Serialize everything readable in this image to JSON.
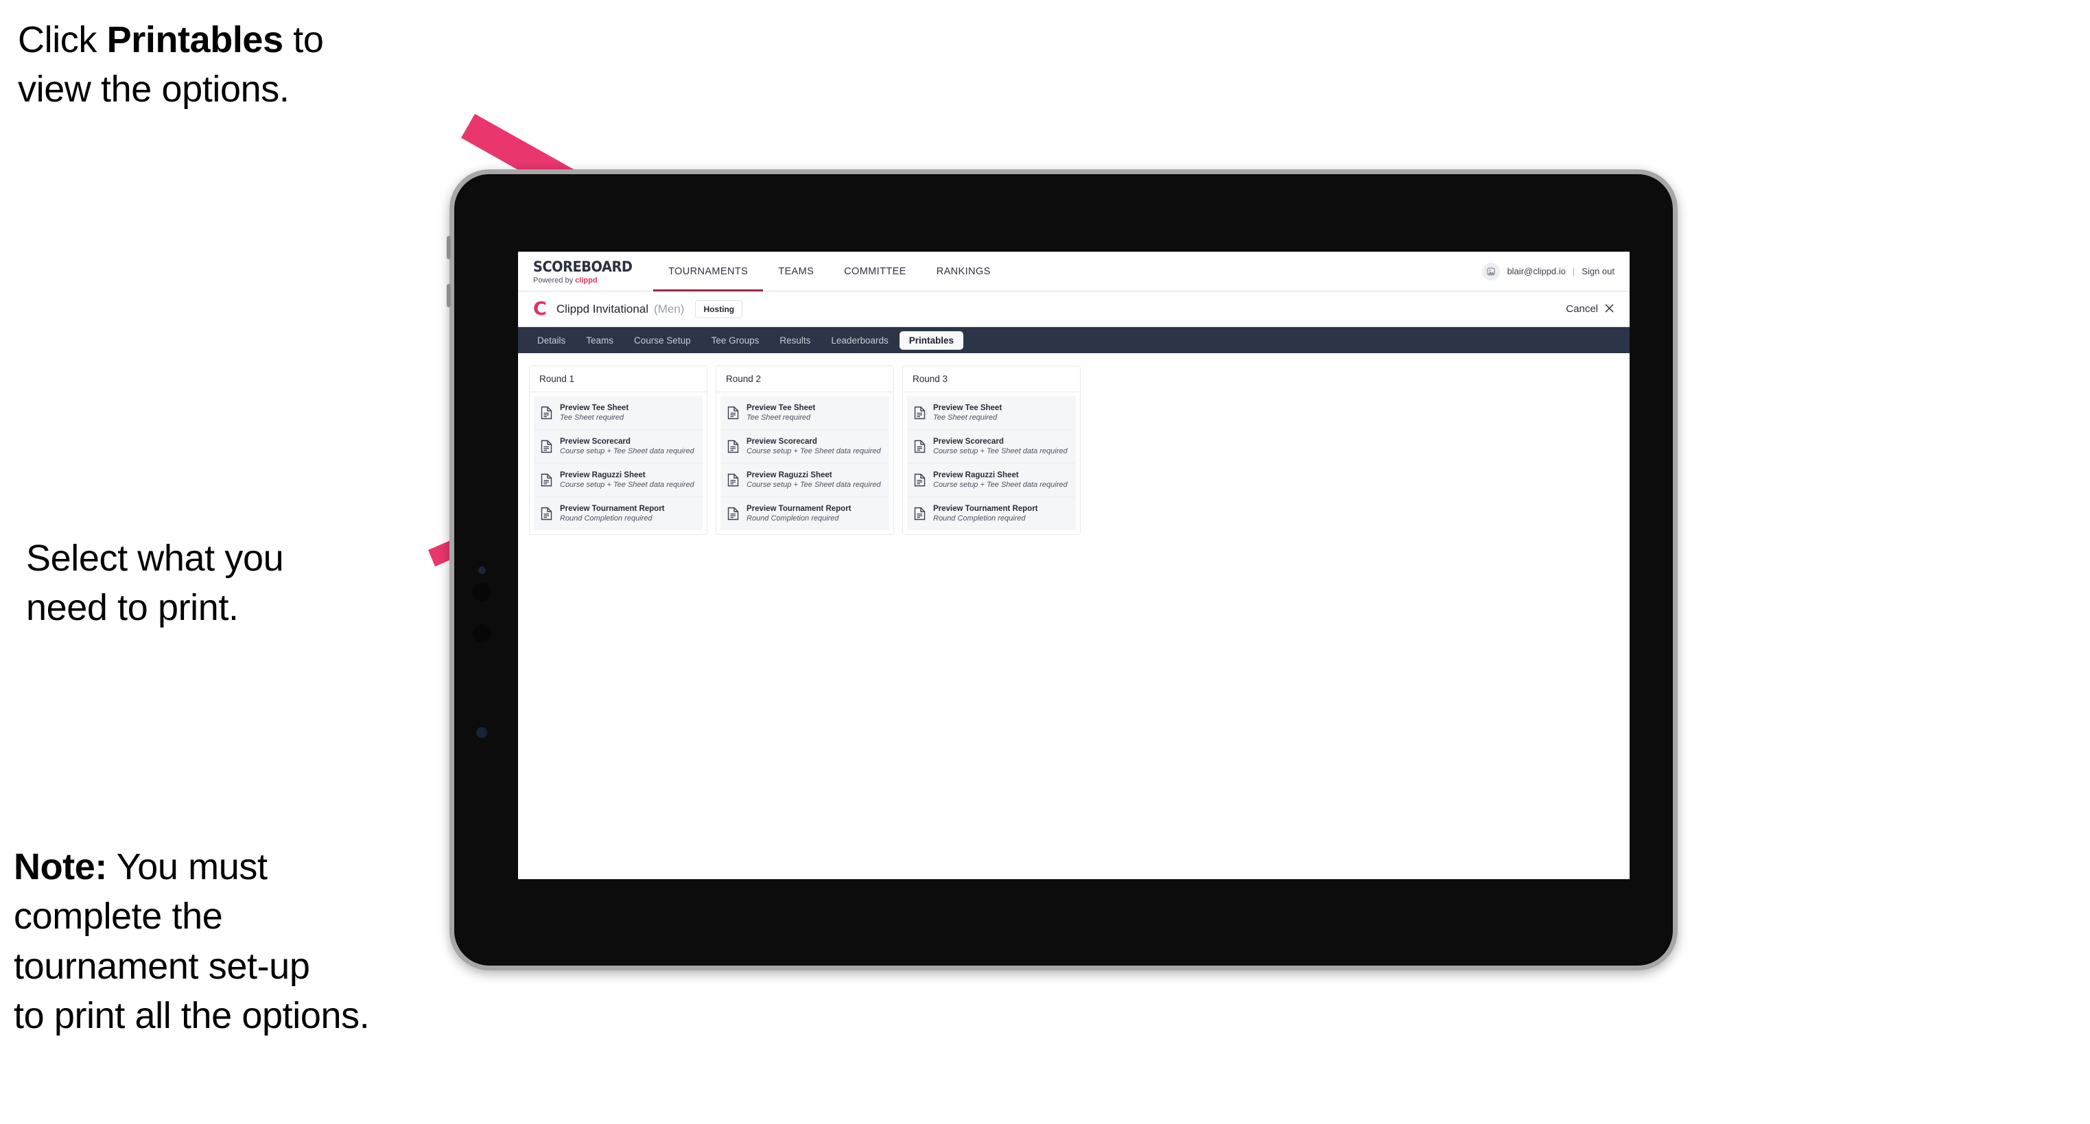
{
  "annotations": {
    "click_printables": "Click Printables to view the options.",
    "click_printables_pre": "Click ",
    "click_printables_bold": "Printables",
    "click_printables_post": " to\nview the options.",
    "select_print": "Select what you\n need to print.",
    "note_bold": "Note:",
    "note_rest": " You must\ncomplete the\ntournament set-up\nto print all the options."
  },
  "colors": {
    "accent_pink": "#e9366d",
    "brand_pink": "#e0335f",
    "tabbar_bg": "#2b3547",
    "active_underline": "#9c2744"
  },
  "app": {
    "brand": {
      "title": "SCOREBOARD",
      "subtitle_pre": "Powered by ",
      "subtitle_brand": "clippd"
    },
    "topnav": {
      "items": [
        {
          "label": "TOURNAMENTS",
          "active": true
        },
        {
          "label": "TEAMS",
          "active": false
        },
        {
          "label": "COMMITTEE",
          "active": false
        },
        {
          "label": "RANKINGS",
          "active": false
        }
      ],
      "user": {
        "avatar_icon": "user-avatar-icon",
        "email": "blair@clippd.io",
        "separator": "|",
        "sign_out": "Sign out"
      }
    },
    "subheader": {
      "logo_letter": "C",
      "tournament_name": "Clippd Invitational",
      "gender": "(Men)",
      "status_badge": "Hosting",
      "cancel_label": "Cancel",
      "cancel_icon": "close-icon"
    },
    "tabs": [
      {
        "label": "Details",
        "active": false
      },
      {
        "label": "Teams",
        "active": false
      },
      {
        "label": "Course Setup",
        "active": false
      },
      {
        "label": "Tee Groups",
        "active": false
      },
      {
        "label": "Results",
        "active": false
      },
      {
        "label": "Leaderboards",
        "active": false
      },
      {
        "label": "Printables",
        "active": true
      }
    ],
    "rounds": [
      {
        "title": "Round 1",
        "items": [
          {
            "title": "Preview Tee Sheet",
            "sub": "Tee Sheet required"
          },
          {
            "title": "Preview Scorecard",
            "sub": "Course setup + Tee Sheet data required"
          },
          {
            "title": "Preview Raguzzi Sheet",
            "sub": "Course setup + Tee Sheet data required"
          },
          {
            "title": "Preview Tournament Report",
            "sub": "Round Completion required"
          }
        ]
      },
      {
        "title": "Round 2",
        "items": [
          {
            "title": "Preview Tee Sheet",
            "sub": "Tee Sheet required"
          },
          {
            "title": "Preview Scorecard",
            "sub": "Course setup + Tee Sheet data required"
          },
          {
            "title": "Preview Raguzzi Sheet",
            "sub": "Course setup + Tee Sheet data required"
          },
          {
            "title": "Preview Tournament Report",
            "sub": "Round Completion required"
          }
        ]
      },
      {
        "title": "Round 3",
        "items": [
          {
            "title": "Preview Tee Sheet",
            "sub": "Tee Sheet required"
          },
          {
            "title": "Preview Scorecard",
            "sub": "Course setup + Tee Sheet data required"
          },
          {
            "title": "Preview Raguzzi Sheet",
            "sub": "Course setup + Tee Sheet data required"
          },
          {
            "title": "Preview Tournament Report",
            "sub": "Round Completion required"
          }
        ]
      }
    ]
  }
}
